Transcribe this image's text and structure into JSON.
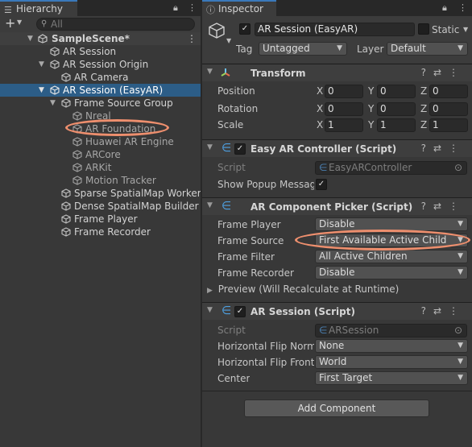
{
  "hierarchy": {
    "tab_label": "Hierarchy",
    "add_label": "+",
    "search_placeholder": "All",
    "items": [
      {
        "label": "SampleScene*"
      },
      {
        "label": "AR Session"
      },
      {
        "label": "AR Session Origin"
      },
      {
        "label": "AR Camera"
      },
      {
        "label": "AR Session (EasyAR)"
      },
      {
        "label": "Frame Source Group"
      },
      {
        "label": "Nreal"
      },
      {
        "label": "AR Foundation"
      },
      {
        "label": "Huawei AR Engine"
      },
      {
        "label": "ARCore"
      },
      {
        "label": "ARKit"
      },
      {
        "label": "Motion Tracker"
      },
      {
        "label": "Sparse SpatialMap Worker"
      },
      {
        "label": "Dense SpatialMap Builder"
      },
      {
        "label": "Frame Player"
      },
      {
        "label": "Frame Recorder"
      }
    ]
  },
  "inspector": {
    "tab_label": "Inspector",
    "object_name": "AR Session (EasyAR)",
    "static_label": "Static",
    "tag_label": "Tag",
    "tag_value": "Untagged",
    "layer_label": "Layer",
    "layer_value": "Default",
    "transform": {
      "title": "Transform",
      "rows": [
        {
          "label": "Position",
          "x": "0",
          "y": "0",
          "z": "0"
        },
        {
          "label": "Rotation",
          "x": "0",
          "y": "0",
          "z": "0"
        },
        {
          "label": "Scale",
          "x": "1",
          "y": "1",
          "z": "1"
        }
      ],
      "axis_x": "X",
      "axis_y": "Y",
      "axis_z": "Z"
    },
    "easy_ar_controller": {
      "title": "Easy AR Controller (Script)",
      "script_label": "Script",
      "script_value": "EasyARController",
      "popup_label": "Show Popup Messag"
    },
    "component_picker": {
      "title": "AR Component Picker (Script)",
      "rows": [
        {
          "label": "Frame Player",
          "value": "Disable"
        },
        {
          "label": "Frame Source",
          "value": "First Available Active Child"
        },
        {
          "label": "Frame Filter",
          "value": "All Active Children"
        },
        {
          "label": "Frame Recorder",
          "value": "Disable"
        }
      ],
      "preview_label": "Preview (Will Recalculate at Runtime)"
    },
    "ar_session": {
      "title": "AR Session (Script)",
      "script_label": "Script",
      "script_value": "ARSession",
      "rows": [
        {
          "label": "Horizontal Flip Norma",
          "value": "None"
        },
        {
          "label": "Horizontal Flip Front",
          "value": "World"
        },
        {
          "label": "Center",
          "value": "First Target"
        }
      ]
    },
    "add_component_label": "Add Component"
  },
  "colors": {
    "selection": "#2c5d87",
    "highlight": "#ee8f6e",
    "accent": "#3a79bb"
  },
  "icons": [
    "hierarchy-icon",
    "lock-icon",
    "menu-icon",
    "search-icon",
    "unity-scene-icon",
    "gameobject-cube-icon",
    "info-icon",
    "transform-icon",
    "script-icon",
    "help-icon",
    "preset-icon",
    "dropdown-caret-icon",
    "fold-arrow-icon"
  ]
}
